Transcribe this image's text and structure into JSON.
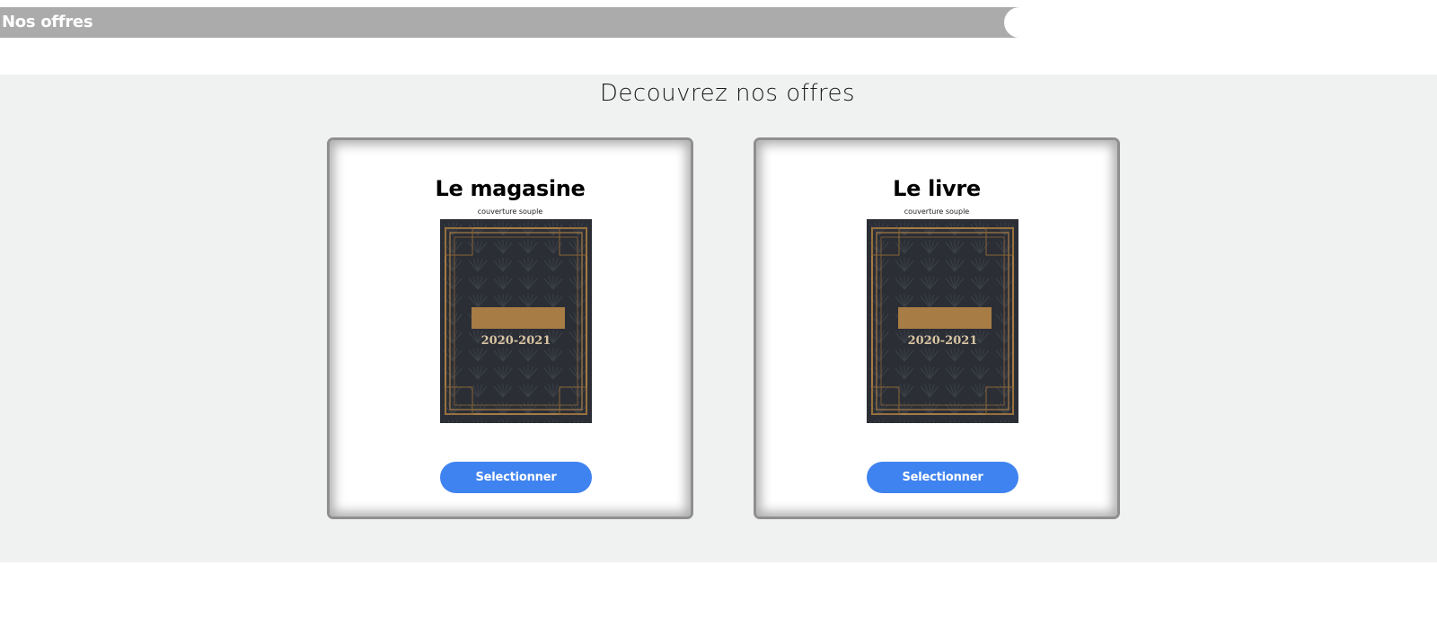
{
  "header": {
    "title": "Nos offres"
  },
  "offers_section": {
    "heading": "Decouvrez nos offres",
    "cards": [
      {
        "title": "Le magasine",
        "subtitle": "couverture souple",
        "cover_year": "2020-2021",
        "button_label": "Selectionner"
      },
      {
        "title": "Le livre",
        "subtitle": "couverture souple",
        "cover_year": "2020-2021",
        "button_label": "Selectionner"
      }
    ]
  },
  "colors": {
    "header_bar": "#ababab",
    "section_background": "#f0f2f1",
    "button_blue": "#3f83f0",
    "cover_dark": "#2b2e35",
    "cover_gold": "#a77c45"
  }
}
